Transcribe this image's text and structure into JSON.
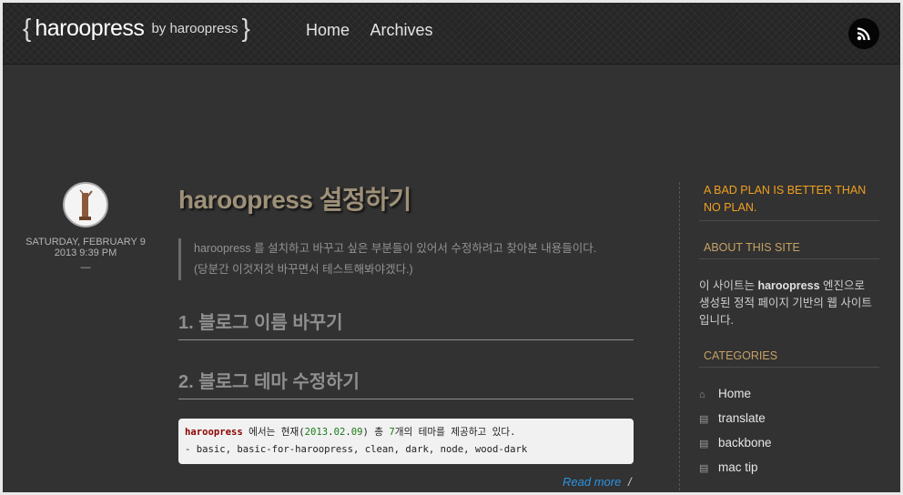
{
  "header": {
    "brace_open": "{",
    "brace_close": "}",
    "site_name": "haroopress",
    "by_line": "by haroopress",
    "nav": [
      {
        "label": "Home"
      },
      {
        "label": "Archives"
      }
    ],
    "rss_icon": "rss-icon"
  },
  "post": {
    "date": "SATURDAY, FEBRUARY 9",
    "time": "2013 9:39 PM",
    "dash": "—",
    "title": "haroopress 설정하기",
    "summary_line1": "haroopress 를 설치하고 바꾸고 싶은 부분들이 있어서 수정하려고 찾아본 내용들이다.",
    "summary_line2": "(당분간 이것저것 바꾸면서 테스트해봐야겠다.)",
    "section1": "1. 블로그 이름 바꾸기",
    "section2": "2. 블로그 테마 수정하기",
    "code": {
      "name": "haroopress",
      "t1": " 에서는 현재(",
      "y": "2013",
      "dot1": ".",
      "m": "02",
      "dot2": ".",
      "d": "09",
      "t2": ") 총 ",
      "n": "7",
      "t3": "개의 테마를 제공하고 있다.",
      "line2": "- basic, basic-for-haroopress, clean, dark, node, wood-dark"
    },
    "read_more": "Read more",
    "slash": "/"
  },
  "sidebar": {
    "quote_line1": "A BAD PLAN IS BETTER THAN",
    "quote_line2": "NO PLAN.",
    "about_heading": "ABOUT THIS SITE",
    "about_pre": "이 사이트는 ",
    "about_bold": "haroopress",
    "about_line1_rest": " 엔진으로",
    "about_line2": "생성된 정적 페이지 기반의 웹 사이트",
    "about_line3": "입니다.",
    "categories_heading": "CATEGORIES",
    "categories": [
      {
        "label": "Home",
        "icon": "home-icon"
      },
      {
        "label": "translate",
        "icon": "book-icon"
      },
      {
        "label": "backbone",
        "icon": "book-icon"
      },
      {
        "label": "mac tip",
        "icon": "book-icon"
      }
    ]
  },
  "colors": {
    "background": "#323232",
    "title": "#9e9179",
    "accent_quote": "#f0a020",
    "section_heading": "#c6a065",
    "link": "#2a93e0"
  }
}
